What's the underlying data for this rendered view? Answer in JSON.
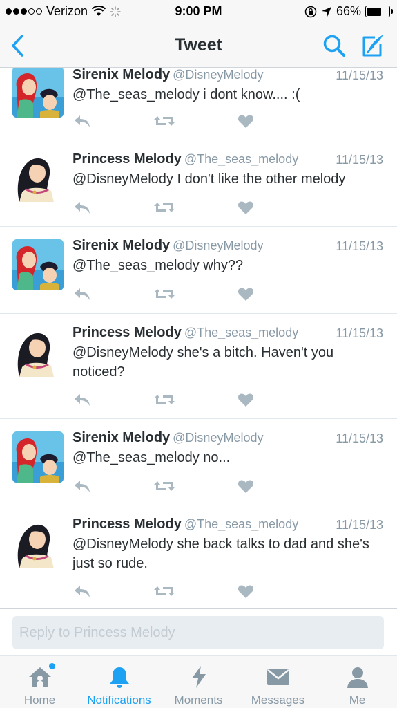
{
  "status_bar": {
    "carrier": "Verizon",
    "time": "9:00 PM",
    "battery": "66%",
    "battery_level": 0.66
  },
  "nav": {
    "title": "Tweet"
  },
  "tweets": [
    {
      "name": "Sirenix Melody",
      "handle": "@DisneyMelody",
      "date": "11/15/13",
      "text": "@The_seas_melody i dont know.... :(",
      "avatar": "ariel-and-eric"
    },
    {
      "name": "Princess Melody",
      "handle": "@The_seas_melody",
      "date": "11/15/13",
      "text": "@DisneyMelody I don't like the other melody",
      "avatar": "melody"
    },
    {
      "name": "Sirenix Melody",
      "handle": "@DisneyMelody",
      "date": "11/15/13",
      "text": "@The_seas_melody why??",
      "avatar": "ariel-and-eric"
    },
    {
      "name": "Princess Melody",
      "handle": "@The_seas_melody",
      "date": "11/15/13",
      "text": "@DisneyMelody she's a bitch. Haven't you noticed?",
      "avatar": "melody"
    },
    {
      "name": "Sirenix Melody",
      "handle": "@DisneyMelody",
      "date": "11/15/13",
      "text": "@The_seas_melody no...",
      "avatar": "ariel-and-eric"
    },
    {
      "name": "Princess Melody",
      "handle": "@The_seas_melody",
      "date": "11/15/13",
      "text": "@DisneyMelody she back talks to dad and she's just so rude.",
      "avatar": "melody"
    }
  ],
  "reply": {
    "placeholder": "Reply to Princess Melody"
  },
  "tabs": [
    {
      "label": "Home",
      "icon": "home-icon",
      "active": false
    },
    {
      "label": "Notifications",
      "icon": "bell-icon",
      "active": true
    },
    {
      "label": "Moments",
      "icon": "lightning-icon",
      "active": false
    },
    {
      "label": "Messages",
      "icon": "envelope-icon",
      "active": false
    },
    {
      "label": "Me",
      "icon": "person-icon",
      "active": false
    }
  ],
  "colors": {
    "accent": "#1da1f2",
    "muted": "#8899a6",
    "text": "#292f33"
  }
}
